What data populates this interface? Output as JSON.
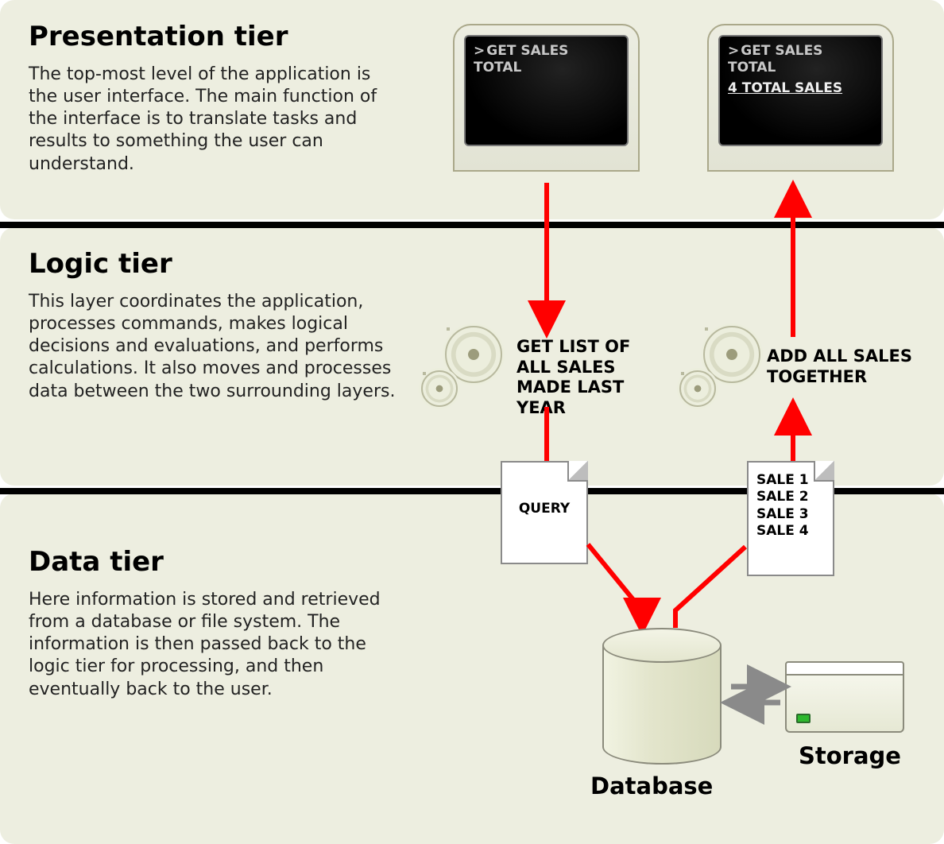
{
  "tiers": {
    "presentation": {
      "title": "Presentation tier",
      "desc": "The top-most level of the application is the user interface. The main function of the interface is to translate tasks and results to something the user can understand."
    },
    "logic": {
      "title": "Logic tier",
      "desc": "This layer coordinates the application, processes commands, makes logical decisions and evaluations, and performs calculations.  It also moves and processes data between the two surrounding layers."
    },
    "data": {
      "title": "Data tier",
      "desc": "Here information is stored and retrieved from a database or file system.  The information is then passed back to the logic tier for processing, and then eventually back to the user."
    }
  },
  "screens": {
    "left": {
      "prompt": ">",
      "command": "GET SALES TOTAL"
    },
    "right": {
      "prompt": ">",
      "command": "GET SALES TOTAL",
      "result": "4 TOTAL SALES"
    }
  },
  "logic_actions": {
    "left": "GET LIST OF ALL SALES MADE LAST YEAR",
    "right": "ADD ALL SALES TOGETHER"
  },
  "documents": {
    "query": "QUERY",
    "results": [
      "SALE 1",
      "SALE 2",
      "SALE 3",
      "SALE 4"
    ]
  },
  "labels": {
    "database": "Database",
    "storage": "Storage"
  }
}
